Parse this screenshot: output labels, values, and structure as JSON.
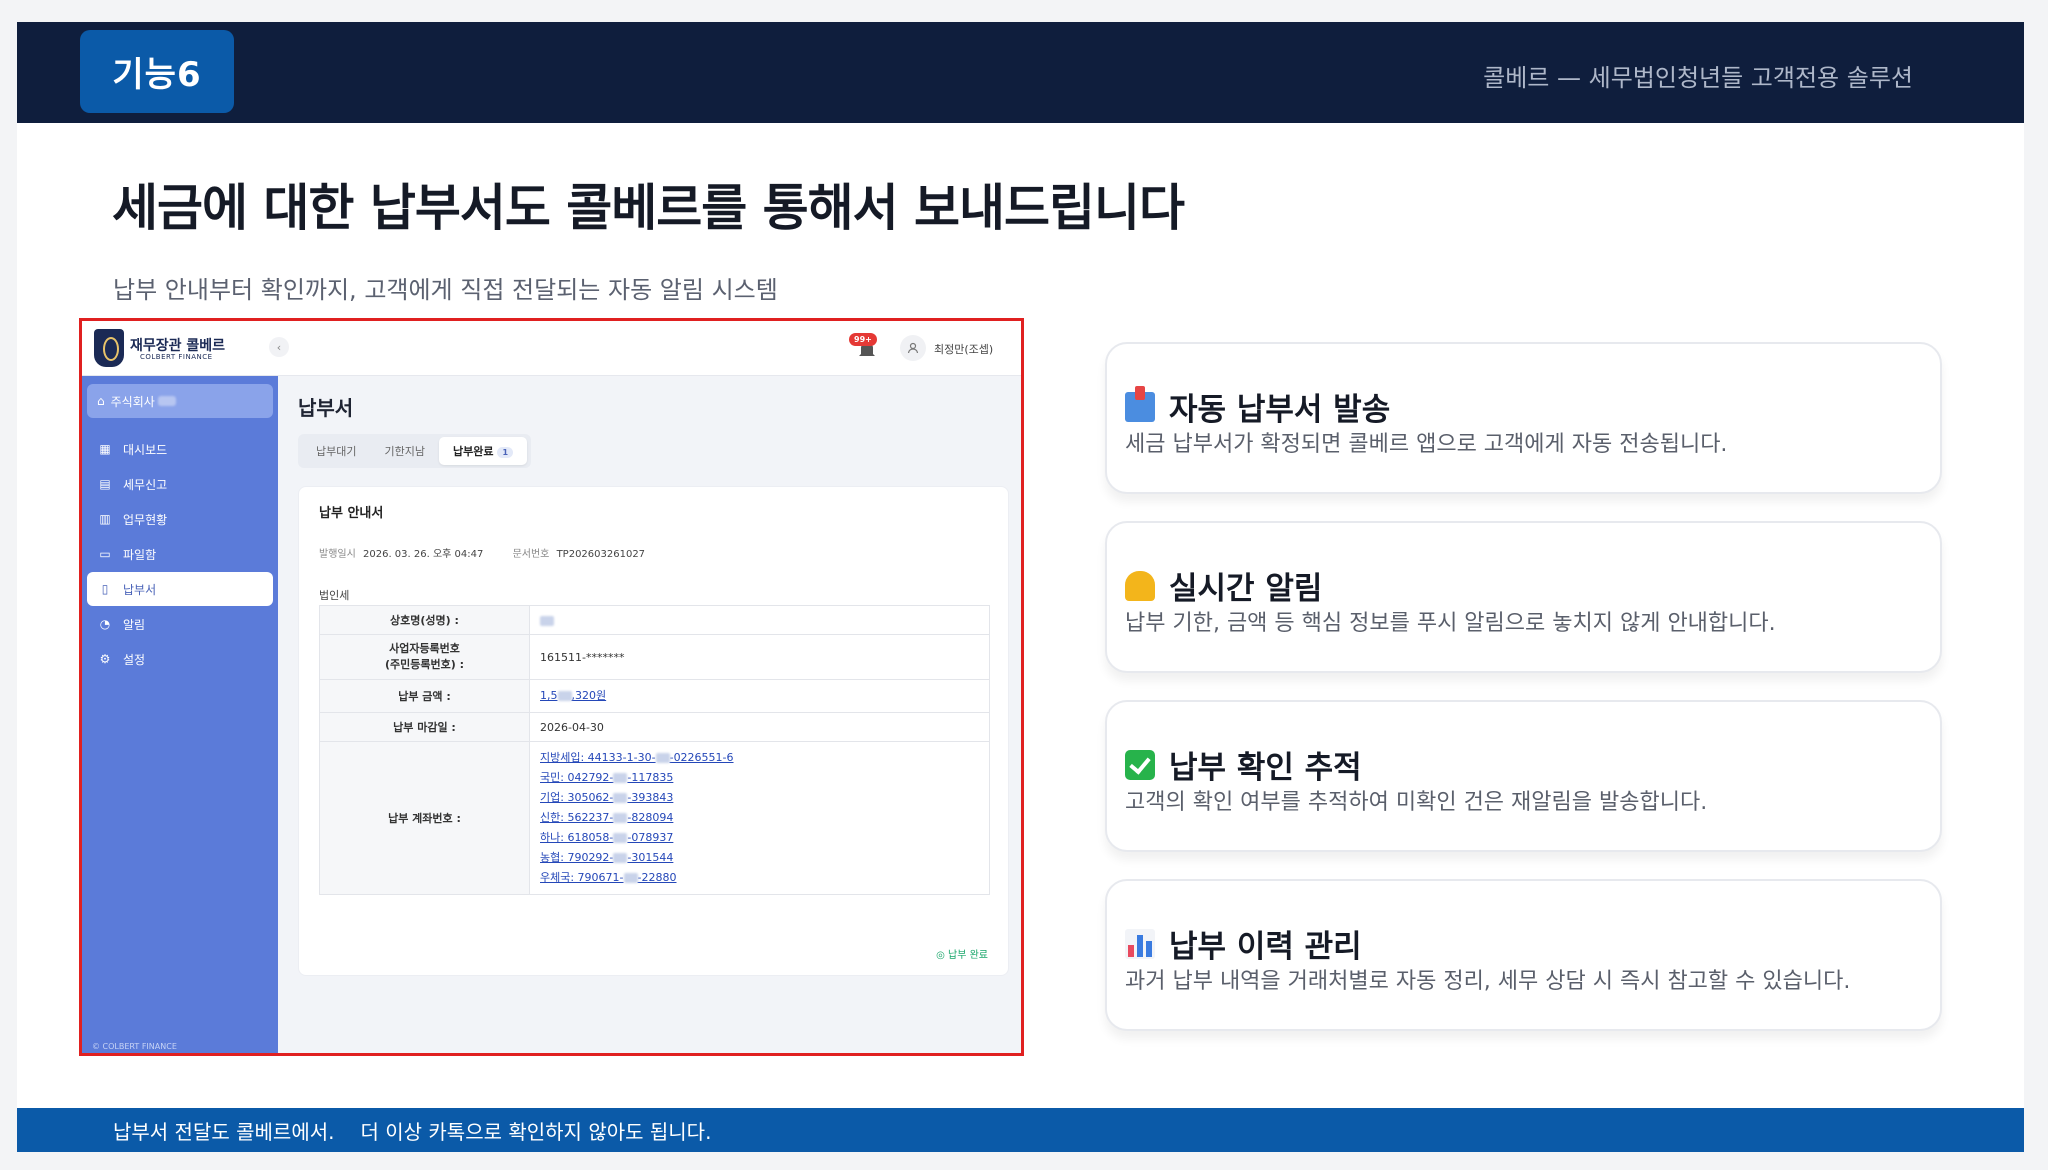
{
  "slide": {
    "badge": "기능6",
    "top_caption": "콜베르 — 세무법인청년들 고객전용 솔루션",
    "headline": "세금에 대한 납부서도 콜베르를 통해서 보내드립니다",
    "subline": "납부 안내부터 확인까지, 고객에게 직접 전달되는 자동 알림 시스템",
    "footer_left": "납부서 전달도 콜베르에서.",
    "footer_right": "더 이상 카톡으로 확인하지 않아도 됩니다."
  },
  "app": {
    "name": "재무장관 콜베르",
    "name_en": "COLBERT FINANCE",
    "collapse": "‹",
    "notification_count": "99+",
    "user_name": "최정만(조셉)",
    "company": "주식회사",
    "sidebar": [
      {
        "label": "대시보드",
        "icon": "dashboard-icon",
        "glyph": "▦"
      },
      {
        "label": "세무신고",
        "icon": "tax-report-icon",
        "glyph": "▤"
      },
      {
        "label": "업무현황",
        "icon": "clipboard-icon",
        "glyph": "▥"
      },
      {
        "label": "파일함",
        "icon": "folder-icon",
        "glyph": "▭"
      },
      {
        "label": "납부서",
        "icon": "document-icon",
        "glyph": "▯",
        "active": true
      },
      {
        "label": "알림",
        "icon": "bell-icon",
        "glyph": "◔"
      },
      {
        "label": "설정",
        "icon": "gear-icon",
        "glyph": "⚙"
      }
    ],
    "footer": "© COLBERT FINANCE",
    "page_title": "납부서",
    "tabs": [
      {
        "label": "납부대기"
      },
      {
        "label": "기한지남"
      },
      {
        "label": "납부완료",
        "count": "1",
        "active": true
      }
    ],
    "card": {
      "title": "납부 안내서",
      "issued_label": "발행일시",
      "issued_value": "2026. 03. 26. 오후 04:47",
      "doc_label": "문서번호",
      "doc_value": "TP202603261027",
      "section": "법인세",
      "rows": {
        "name_label": "상호명(성명) :",
        "bizno_label": "사업자등록번호\n(주민등록번호) :",
        "bizno_value": "161511-*******",
        "amount_label": "납부 금액 :",
        "amount_prefix": "1,5",
        "amount_suffix": ",320원",
        "due_label": "납부 마감일 :",
        "due_value": "2026-04-30",
        "account_label": "납부 계좌번호 :"
      },
      "accounts": [
        {
          "pre": "지방세입: 44133-1-30-",
          "post": "-0226551-6"
        },
        {
          "pre": "국민: 042792-",
          "post": "-117835"
        },
        {
          "pre": "기업: 305062-",
          "post": "-393843"
        },
        {
          "pre": "신한: 562237-",
          "post": "-828094"
        },
        {
          "pre": "하나: 618058-",
          "post": "-078937"
        },
        {
          "pre": "농협: 790292-",
          "post": "-301544"
        },
        {
          "pre": "우체국: 790671-",
          "post": "-22880"
        }
      ],
      "status": "납부 완료"
    }
  },
  "features": [
    {
      "icon": "inbox-tray-icon",
      "title": "자동 납부서 발송",
      "desc": "세금 납부서가 확정되면 콜베르 앱으로 고객에게 자동 전송됩니다."
    },
    {
      "icon": "bell-icon",
      "title": "실시간 알림",
      "desc": "납부 기한, 금액 등 핵심 정보를 푸시 알림으로 놓치지 않게 안내합니다."
    },
    {
      "icon": "check-mark-icon",
      "title": "납부 확인 추적",
      "desc": "고객의 확인 여부를 추적하여 미확인 건은 재알림을 발송합니다."
    },
    {
      "icon": "bar-chart-icon",
      "title": "납부 이력 관리",
      "desc": "과거 납부 내역을 거래처별로 자동 정리, 세무 상담 시 즉시 참고할 수 있습니다."
    }
  ],
  "colors": {
    "navy": "#0f1e3d",
    "accent_blue": "#0b5aa8",
    "sidebar_blue": "#5b7bd9",
    "highlight_red": "#e02020"
  }
}
